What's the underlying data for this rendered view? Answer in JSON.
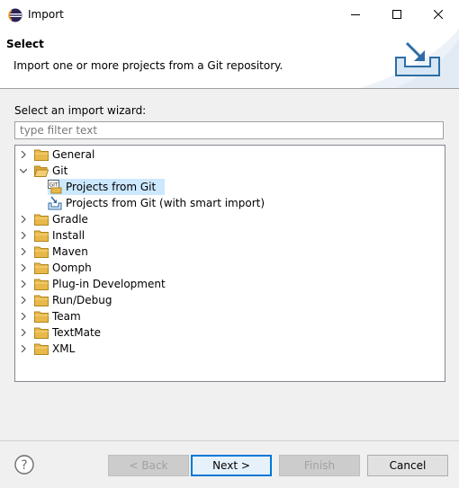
{
  "window": {
    "title": "Import"
  },
  "header": {
    "title": "Select",
    "description": "Import one or more projects from a Git repository."
  },
  "wizard": {
    "label": "Select an import wizard:",
    "filter_placeholder": "type filter text"
  },
  "tree": {
    "items": [
      {
        "label": "General",
        "expanded": false
      },
      {
        "label": "Git",
        "expanded": true,
        "children": [
          {
            "label": "Projects from Git",
            "icon": "git-projects-icon",
            "selected": true
          },
          {
            "label": "Projects from Git (with smart import)",
            "icon": "smart-import-icon",
            "selected": false
          }
        ]
      },
      {
        "label": "Gradle",
        "expanded": false
      },
      {
        "label": "Install",
        "expanded": false
      },
      {
        "label": "Maven",
        "expanded": false
      },
      {
        "label": "Oomph",
        "expanded": false
      },
      {
        "label": "Plug-in Development",
        "expanded": false
      },
      {
        "label": "Run/Debug",
        "expanded": false
      },
      {
        "label": "Team",
        "expanded": false
      },
      {
        "label": "TextMate",
        "expanded": false
      },
      {
        "label": "XML",
        "expanded": false
      }
    ]
  },
  "buttons": {
    "back": "< Back",
    "next": "Next >",
    "finish": "Finish",
    "cancel": "Cancel"
  },
  "colors": {
    "accent": "#0078d7",
    "selection": "#cce8ff",
    "folder": "#e8b94a"
  }
}
